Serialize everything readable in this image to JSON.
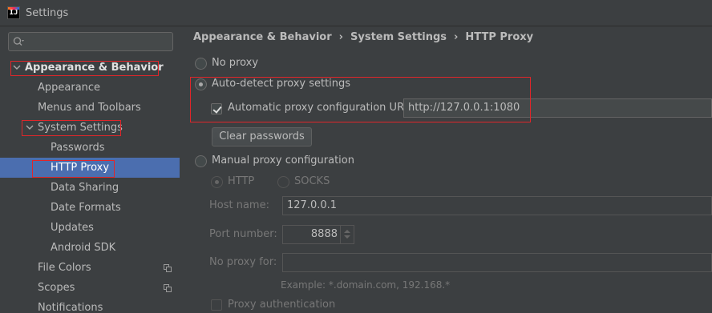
{
  "window": {
    "title": "Settings",
    "app_icon": "intellij-icon",
    "app_icon_text": "IJ"
  },
  "sidebar": {
    "search_placeholder": "",
    "items": [
      {
        "label": "Appearance & Behavior",
        "expanded": true
      },
      {
        "label": "Appearance"
      },
      {
        "label": "Menus and Toolbars"
      },
      {
        "label": "System Settings",
        "expanded": true
      },
      {
        "label": "Passwords"
      },
      {
        "label": "HTTP Proxy",
        "selected": true
      },
      {
        "label": "Data Sharing"
      },
      {
        "label": "Date Formats"
      },
      {
        "label": "Updates"
      },
      {
        "label": "Android SDK"
      },
      {
        "label": "File Colors",
        "icon": "copy-icon"
      },
      {
        "label": "Scopes",
        "icon": "copy-icon"
      },
      {
        "label": "Notifications"
      }
    ]
  },
  "breadcrumb": {
    "items": [
      "Appearance & Behavior",
      "System Settings",
      "HTTP Proxy"
    ],
    "separator": "›"
  },
  "proxy": {
    "no_proxy_label": "No proxy",
    "auto_detect_label": "Auto-detect proxy settings",
    "auto_url_label": "Automatic proxy configuration URL:",
    "auto_url_value": "http://127.0.0.1:1080",
    "clear_passwords_label": "Clear passwords",
    "manual_label": "Manual proxy configuration",
    "http_label": "HTTP",
    "socks_label": "SOCKS",
    "host_label": "Host name:",
    "host_value": "127.0.0.1",
    "port_label": "Port number:",
    "port_value": "8888",
    "no_proxy_for_label": "No proxy for:",
    "no_proxy_for_value": "",
    "example_text": "Example: *.domain.com, 192.168.*",
    "proxy_auth_label": "Proxy authentication"
  },
  "colors": {
    "selection": "#4b6eaf",
    "highlight_box": "#e0262a",
    "background": "#3c3f41"
  }
}
